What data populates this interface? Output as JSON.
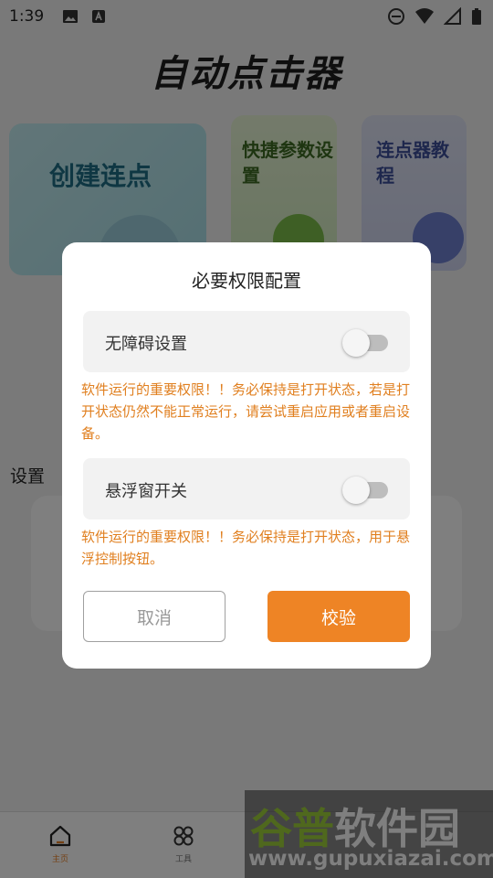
{
  "status_bar": {
    "time": "1:39"
  },
  "app": {
    "title": "自动点击器",
    "cards": [
      {
        "label": "创建连点"
      },
      {
        "label": "快捷参数设置"
      },
      {
        "label": "连点器教程"
      }
    ],
    "settings_heading": "设置"
  },
  "bottom_nav": {
    "items": [
      {
        "label": "主页",
        "icon": "home-icon",
        "active": true
      },
      {
        "label": "工具",
        "icon": "grid-icon",
        "active": false
      }
    ]
  },
  "dialog": {
    "title": "必要权限配置",
    "permissions": [
      {
        "label": "无障碍设置",
        "enabled": false,
        "note": "软件运行的重要权限！！务必保持是打开状态，若是打开状态仍然不能正常运行，请尝试重启应用或者重启设备。"
      },
      {
        "label": "悬浮窗开关",
        "enabled": false,
        "note": "软件运行的重要权限！！务必保持是打开状态，用于悬浮控制按钮。"
      }
    ],
    "cancel_label": "取消",
    "verify_label": "校验"
  },
  "watermark": {
    "brand_prefix": "谷普",
    "brand_suffix": "软件园",
    "url": "www.gupuxiazai.com"
  },
  "colors": {
    "accent": "#ee8425",
    "note_text": "#e07f1f"
  }
}
